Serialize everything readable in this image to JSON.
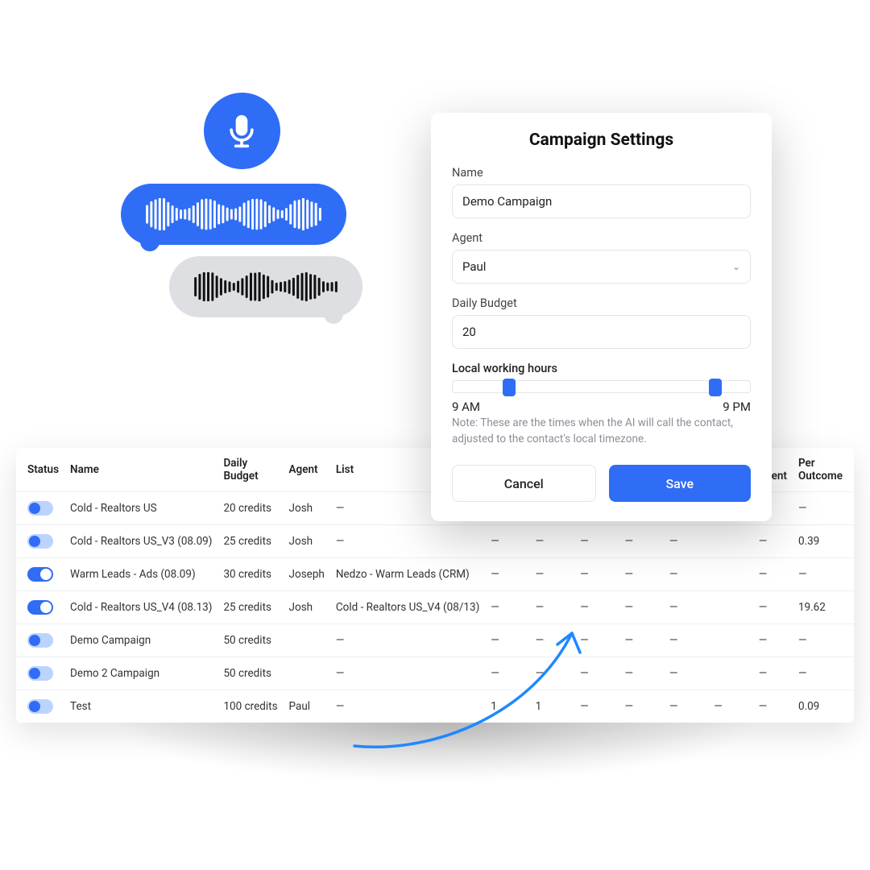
{
  "modal": {
    "title": "Campaign Settings",
    "name_label": "Name",
    "name_value": "Demo Campaign",
    "agent_label": "Agent",
    "agent_value": "Paul",
    "budget_label": "Daily Budget",
    "budget_value": "20",
    "hours_label": "Local working hours",
    "hours_start": "9 AM",
    "hours_end": "9 PM",
    "note": "Note: These are the times when the AI will call the contact, adjusted to the contact's local timezone.",
    "cancel": "Cancel",
    "save": "Save"
  },
  "headers": {
    "status": "Status",
    "name": "Name",
    "daily_budget": "Daily Budget",
    "agent": "Agent",
    "list": "List",
    "spent_trunc": "s Spent",
    "per_outcome": "Per Outcome"
  },
  "rows": [
    {
      "status": "off",
      "name": "Cold - Realtors US",
      "budget": "20 credits",
      "agent": "Josh",
      "list": "—",
      "c1": "—",
      "c2": "—",
      "c3": "—",
      "spent": "—",
      "outcome": "—"
    },
    {
      "status": "off",
      "name": "Cold - Realtors US_V3 (08.09)",
      "budget": "25 credits",
      "agent": "Josh",
      "list": "—",
      "c1": "—",
      "c2": "—",
      "c3": "—",
      "spent": "—",
      "outcome": "0.39"
    },
    {
      "status": "on",
      "name": "Warm Leads - Ads (08.09)",
      "budget": "30 credits",
      "agent": "Joseph",
      "list": "Nedzo - Warm Leads (CRM)",
      "c1": "—",
      "c2": "—",
      "c3": "—",
      "spent": "—",
      "outcome": "—"
    },
    {
      "status": "on",
      "name": "Cold - Realtors US_V4 (08.13)",
      "budget": "25 credits",
      "agent": "Josh",
      "list": "Cold - Realtors US_V4 (08/13)",
      "c1": "—",
      "c2": "—",
      "c3": "—",
      "spent": "—",
      "outcome": "19.62"
    },
    {
      "status": "off",
      "name": "Demo Campaign",
      "budget": "50 credits",
      "agent": "",
      "list": "—",
      "c1": "—",
      "c2": "—",
      "c3": "—",
      "spent": "—",
      "outcome": "—"
    },
    {
      "status": "off",
      "name": "Demo 2 Campaign",
      "budget": "50 credits",
      "agent": "",
      "list": "—",
      "c1": "—",
      "c2": "—",
      "c3": "—",
      "spent": "—",
      "outcome": "—"
    },
    {
      "status": "off",
      "name": "Test",
      "budget": "100 credits",
      "agent": "Paul",
      "list": "—",
      "c1": "1",
      "c2": "1",
      "c3": "—",
      "spent": "—",
      "outcome": "0.09",
      "extra": "—"
    }
  ]
}
